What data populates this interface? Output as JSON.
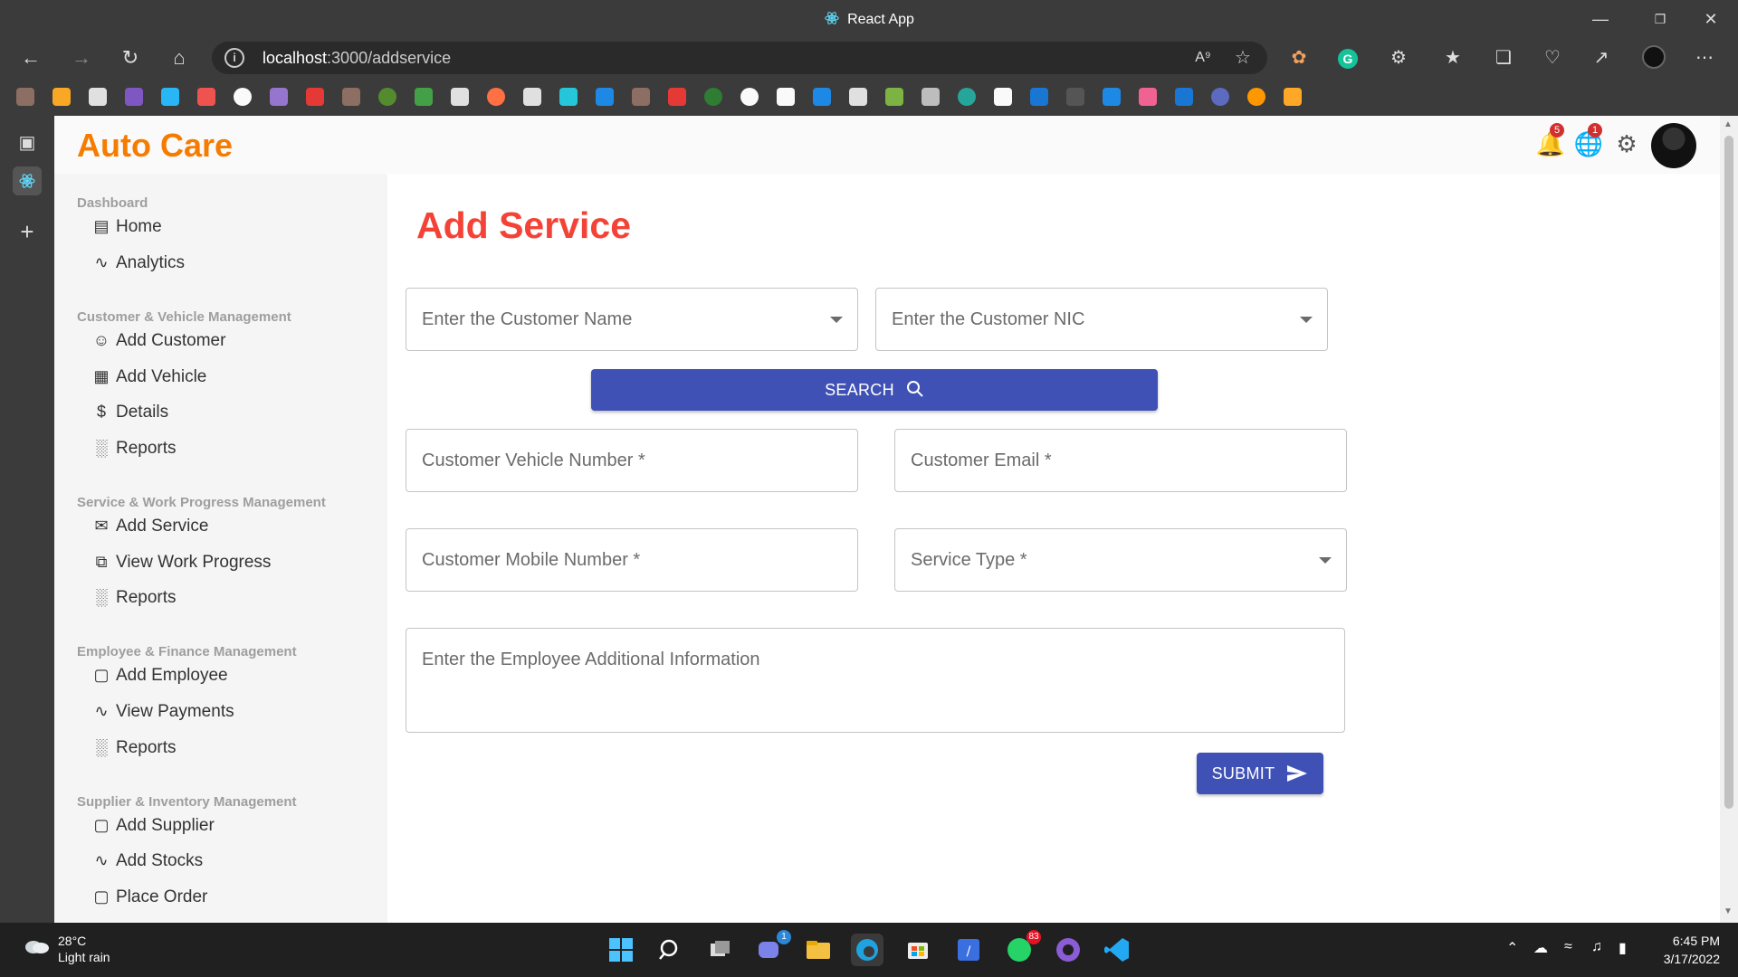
{
  "window": {
    "title": "React App"
  },
  "browser": {
    "url_host": "localhost",
    "url_path": ":3000/addservice"
  },
  "app": {
    "brand": "Auto Care",
    "notifications_badge": "5",
    "language_badge": "1"
  },
  "sidebar": {
    "sections": [
      {
        "title": "Dashboard",
        "items": [
          {
            "label": "Home",
            "icon": "dashboard-icon"
          },
          {
            "label": "Analytics",
            "icon": "trending-icon"
          }
        ]
      },
      {
        "title": "Customer & Vehicle Management",
        "items": [
          {
            "label": "Add Customer",
            "icon": "person-icon"
          },
          {
            "label": "Add Vehicle",
            "icon": "store-icon"
          },
          {
            "label": "Details",
            "icon": "dollar-icon"
          },
          {
            "label": "Reports",
            "icon": "bar-chart-icon"
          }
        ]
      },
      {
        "title": "Service & Work Progress Management",
        "items": [
          {
            "label": "Add Service",
            "icon": "mail-icon"
          },
          {
            "label": "View Work Progress",
            "icon": "library-icon"
          },
          {
            "label": "Reports",
            "icon": "bar-chart-icon"
          }
        ]
      },
      {
        "title": "Employee & Finance Management",
        "items": [
          {
            "label": "Add Employee",
            "icon": "briefcase-icon"
          },
          {
            "label": "View Payments",
            "icon": "trending-icon"
          },
          {
            "label": "Reports",
            "icon": "bar-chart-icon"
          }
        ]
      },
      {
        "title": "Supplier & Inventory Management",
        "items": [
          {
            "label": "Add Supplier",
            "icon": "briefcase-icon"
          },
          {
            "label": "Add Stocks",
            "icon": "trending-icon"
          },
          {
            "label": "Place Order",
            "icon": "briefcase-icon"
          }
        ]
      }
    ]
  },
  "form": {
    "heading": "Add Service",
    "customer_name_placeholder": "Enter the Customer Name",
    "customer_nic_placeholder": "Enter the Customer NIC",
    "search_label": "SEARCH",
    "vehicle_number_label": "Customer Vehicle Number *",
    "email_label": "Customer Email *",
    "mobile_label": "Customer Mobile Number *",
    "service_type_label": "Service Type *",
    "additional_info_placeholder": "Enter the Employee Additional Information",
    "submit_label": "SUBMIT"
  },
  "taskbar": {
    "temperature": "28°C",
    "weather": "Light rain",
    "time": "6:45 PM",
    "date": "3/17/2022",
    "teams_badge": "1",
    "whatsapp_badge": "83"
  },
  "colors": {
    "brand": "#f57c00",
    "heading": "#f44336",
    "primary_button": "#3f51b5"
  }
}
